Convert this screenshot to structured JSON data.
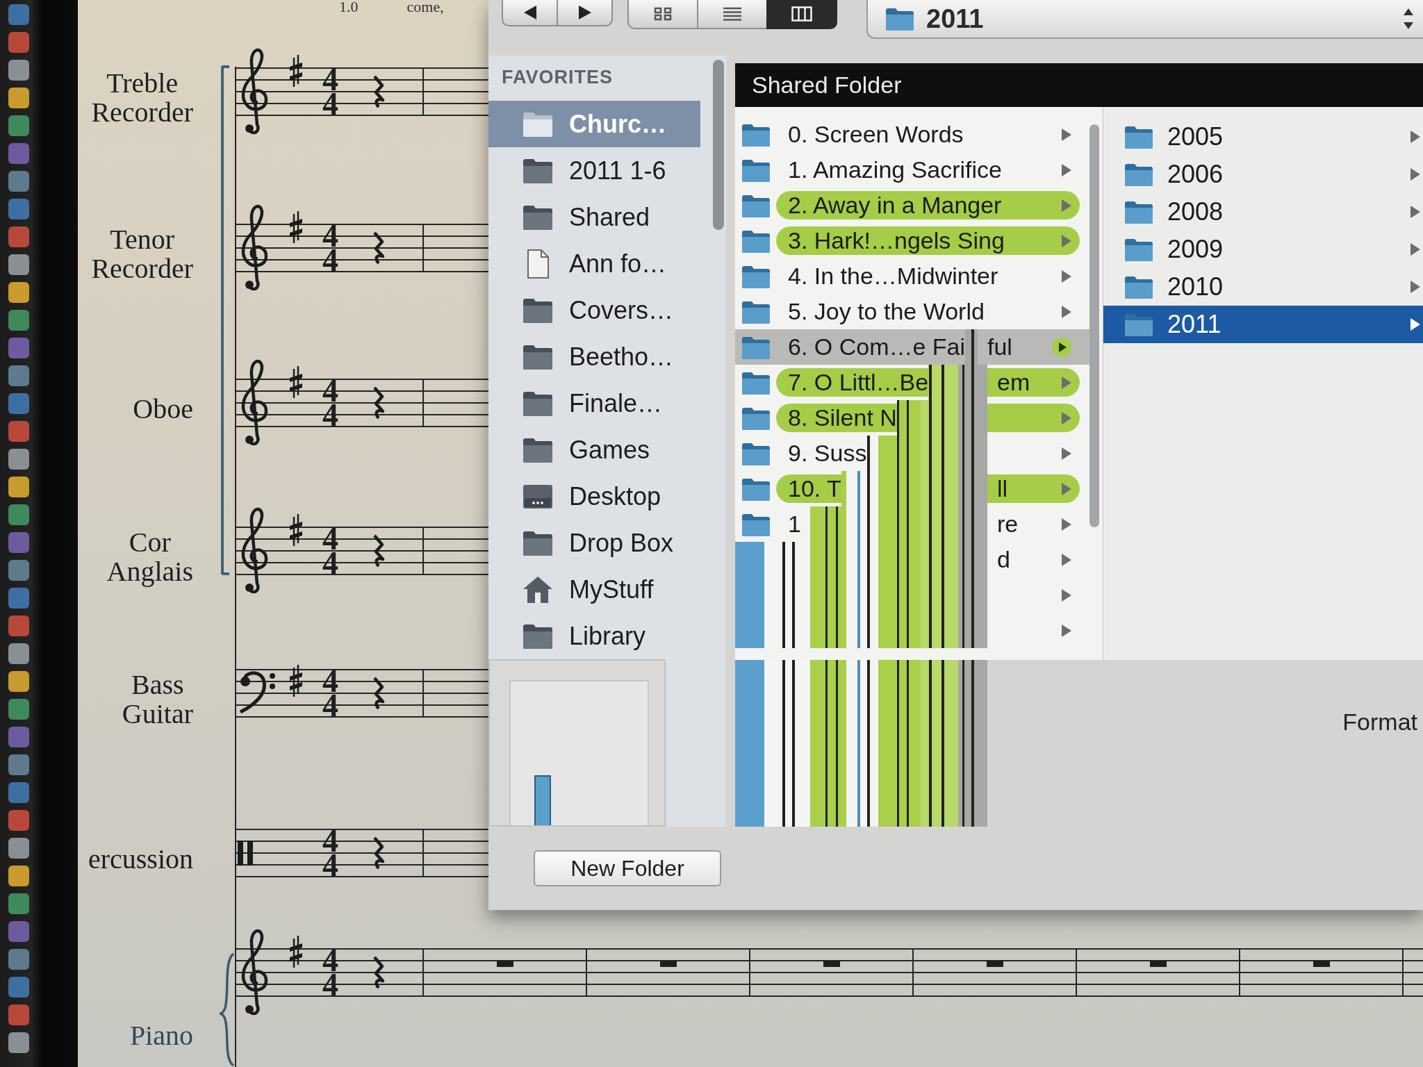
{
  "score": {
    "top_texts": [
      "1.0",
      "come,"
    ],
    "staves": [
      {
        "instrument": "Treble Recorder",
        "kind": "treble",
        "sharp": true,
        "time_signature": {
          "beats": "4",
          "unit": "4"
        },
        "rests": [
          {
            "kind": "quarter"
          }
        ],
        "bracket": true,
        "brace": false
      },
      {
        "instrument": "Tenor Recorder",
        "kind": "treble",
        "sharp": true,
        "time_signature": {
          "beats": "4",
          "unit": "4"
        },
        "rests": [
          {
            "kind": "quarter"
          }
        ],
        "bracket": true,
        "brace": false
      },
      {
        "instrument": "Oboe",
        "kind": "treble",
        "sharp": true,
        "time_signature": {
          "beats": "4",
          "unit": "4"
        },
        "rests": [
          {
            "kind": "quarter"
          }
        ],
        "bracket": true,
        "brace": false
      },
      {
        "instrument": "Cor Anglais",
        "kind": "treble",
        "sharp": true,
        "time_signature": {
          "beats": "4",
          "unit": "4"
        },
        "rests": [
          {
            "kind": "quarter"
          }
        ],
        "bracket": true,
        "brace": false
      },
      {
        "instrument": "Bass Guitar",
        "kind": "bass",
        "sharp": true,
        "time_signature": {
          "beats": "4",
          "unit": "4"
        },
        "rests": [
          {
            "kind": "quarter"
          }
        ],
        "bracket": false,
        "brace": false
      },
      {
        "instrument": "ercussion",
        "kind": "percussion",
        "sharp": false,
        "time_signature": {
          "beats": "4",
          "unit": "4"
        },
        "rests": [
          {
            "kind": "quarter"
          }
        ],
        "bracket": false,
        "brace": false
      },
      {
        "instrument": "Piano",
        "kind": "treble",
        "sharp": true,
        "time_signature": {
          "beats": "4",
          "unit": "4"
        },
        "rests": [
          {
            "kind": "quarter"
          },
          {
            "kind": "whole"
          },
          {
            "kind": "whole"
          },
          {
            "kind": "whole"
          },
          {
            "kind": "whole"
          },
          {
            "kind": "whole"
          },
          {
            "kind": "whole"
          }
        ],
        "bracket": false,
        "brace": true
      }
    ]
  },
  "dialog": {
    "toolbar": {
      "views": [
        {
          "kind": "icon",
          "selected": false
        },
        {
          "kind": "list",
          "selected": false
        },
        {
          "kind": "column",
          "selected": true
        }
      ],
      "location": "2011"
    },
    "sidebar": {
      "heading": "FAVORITES",
      "items": [
        {
          "label": "Churc…",
          "kind": "folder",
          "selected": true
        },
        {
          "label": "2011 1-6",
          "kind": "folder",
          "selected": false
        },
        {
          "label": "Shared",
          "kind": "folder",
          "selected": false
        },
        {
          "label": "Ann fo…",
          "kind": "document",
          "selected": false
        },
        {
          "label": "Covers…",
          "kind": "folder",
          "selected": false
        },
        {
          "label": "Beetho…",
          "kind": "folder",
          "selected": false
        },
        {
          "label": "Finale…",
          "kind": "folder",
          "selected": false
        },
        {
          "label": "Games",
          "kind": "folder",
          "selected": false
        },
        {
          "label": "Desktop",
          "kind": "desktop",
          "selected": false
        },
        {
          "label": "Drop Box",
          "kind": "folder",
          "selected": false
        },
        {
          "label": "MyStuff",
          "kind": "home",
          "selected": false
        },
        {
          "label": "Library",
          "kind": "folder",
          "selected": false
        }
      ]
    },
    "browser": {
      "title": "Shared Folder",
      "columns": [
        {
          "items": [
            {
              "label": "0. Screen Words",
              "selected": false,
              "corrupted": false
            },
            {
              "label": "1. Amazing Sacrifice",
              "selected": false,
              "corrupted": false
            },
            {
              "label": "2. Away in a Manger",
              "selected": false,
              "corrupted": false,
              "color": "#a5cd47"
            },
            {
              "label": "3. Hark!…ngels Sing",
              "selected": false,
              "corrupted": false,
              "color": "#a5cd47"
            },
            {
              "label": "4. In the…Midwinter",
              "selected": false,
              "corrupted": false
            },
            {
              "label": "5. Joy to the World",
              "selected": false,
              "corrupted": false
            },
            {
              "label": "6. O Com…e Fai",
              "tail": "ful",
              "selected": true,
              "corrupted": true,
              "color": "#a5cd47"
            },
            {
              "label": "7. O Littl…Be",
              "tail": "em",
              "selected": false,
              "corrupted": true,
              "color": "#a5cd47"
            },
            {
              "label": "8. Silent N",
              "selected": false,
              "corrupted": true,
              "color": "#a5cd47"
            },
            {
              "label": "9. Suss",
              "selected": false,
              "corrupted": true
            },
            {
              "label": "10. T",
              "tail": "ll",
              "selected": false,
              "corrupted": true,
              "color": "#a5cd47"
            },
            {
              "label": "1",
              "tail": "re",
              "selected": false,
              "corrupted": true
            },
            {
              "tail": "d",
              "selected": false,
              "corrupted": true
            },
            {
              "selected": false,
              "corrupted": true
            },
            {
              "selected": false,
              "corrupted": true
            }
          ]
        },
        {
          "items": [
            {
              "label": "2005",
              "selected": false
            },
            {
              "label": "2006",
              "selected": false
            },
            {
              "label": "2008",
              "selected": false
            },
            {
              "label": "2009",
              "selected": false
            },
            {
              "label": "2010",
              "selected": false
            },
            {
              "label": "2011",
              "selected": true
            }
          ]
        }
      ]
    },
    "format_label": "Format",
    "new_folder_button": "New Folder"
  }
}
